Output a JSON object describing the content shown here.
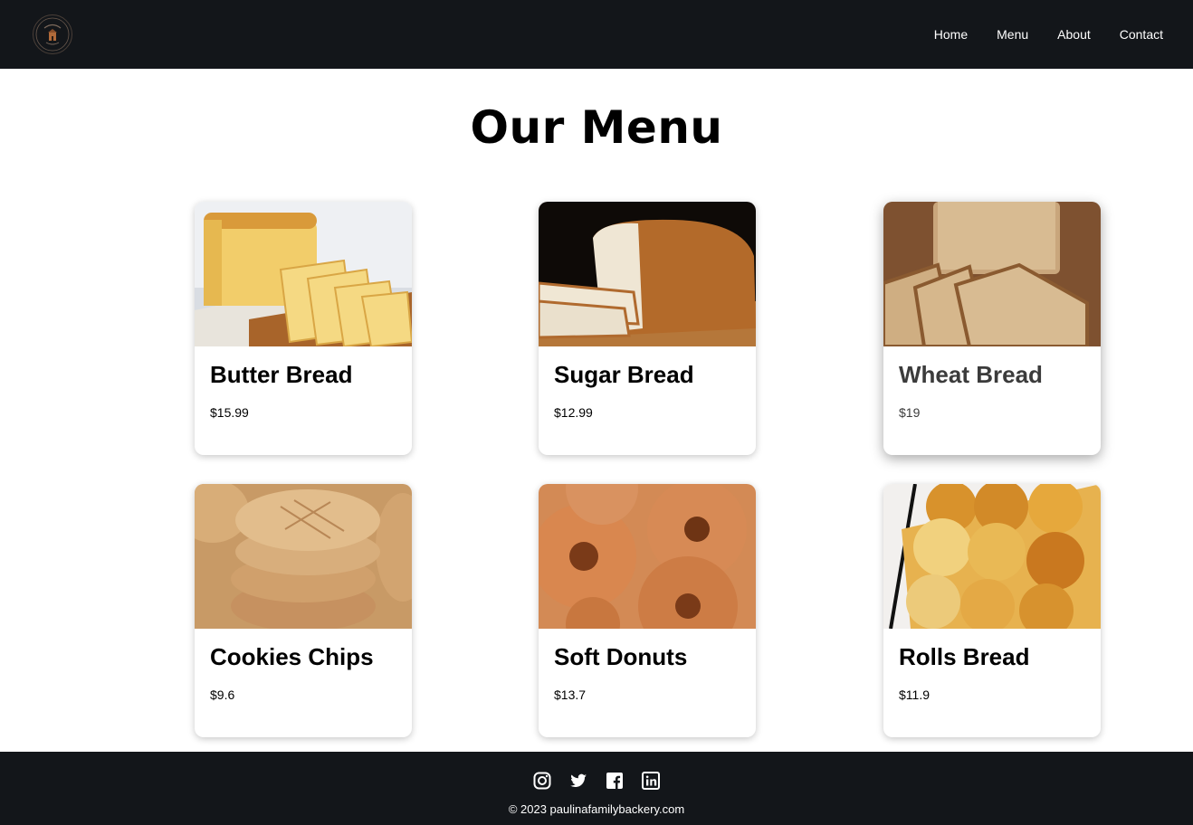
{
  "nav": {
    "logo_alt": "Paulina Family Backery logo",
    "links": [
      {
        "label": "Home"
      },
      {
        "label": "Menu"
      },
      {
        "label": "About"
      },
      {
        "label": "Contact"
      }
    ]
  },
  "main": {
    "title": "Our Menu",
    "items": [
      {
        "name": "Butter Bread",
        "price": "$15.99",
        "image_icon": "butter-bread-image"
      },
      {
        "name": "Sugar Bread",
        "price": "$12.99",
        "image_icon": "sugar-bread-image"
      },
      {
        "name": "Wheat Bread",
        "price": "$19",
        "image_icon": "wheat-bread-image"
      },
      {
        "name": "Cookies Chips",
        "price": "$9.6",
        "image_icon": "cookies-image"
      },
      {
        "name": "Soft Donuts",
        "price": "$13.7",
        "image_icon": "donuts-image"
      },
      {
        "name": "Rolls Bread",
        "price": "$11.9",
        "image_icon": "rolls-image"
      }
    ]
  },
  "footer": {
    "socials": [
      "instagram-icon",
      "twitter-icon",
      "facebook-icon",
      "linkedin-icon"
    ],
    "copyright": "© 2023 paulinafamilybackery.com"
  },
  "colors": {
    "nav_bg": "#13161a",
    "footer_bg": "#13161a",
    "text": "#000000",
    "nav_text": "#ffffff"
  }
}
